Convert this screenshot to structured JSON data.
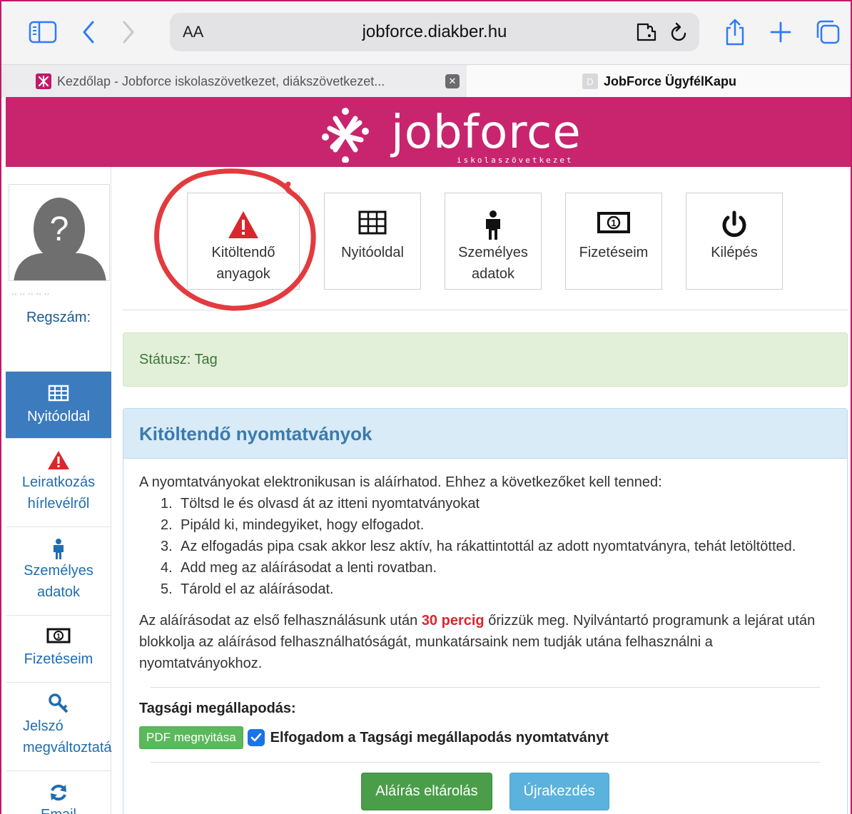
{
  "browser": {
    "aa_label": "AA",
    "url": "jobforce.diakber.hu",
    "tabs": [
      {
        "title": "Kezdőlap - Jobforce iskolaszövetkezet, diákszövetkezet...",
        "favicon": "jobforce-logo-icon"
      },
      {
        "title": "JobForce ÜgyfélKapu",
        "favicon": "D"
      }
    ]
  },
  "brand": {
    "name": "jobforce",
    "subtitle": "iskolaszövetkezet",
    "color": "#c8256e"
  },
  "sidebar": {
    "registration_label": "Regszám:",
    "items": [
      {
        "label": "Nyitóoldal",
        "icon": "table-icon",
        "active": true
      },
      {
        "label": "Leiratkozás hírlevélről",
        "icon": "warning-icon",
        "active": false
      },
      {
        "label": "Személyes adatok",
        "icon": "person-icon",
        "active": false
      },
      {
        "label": "Fizetéseim",
        "icon": "money-icon",
        "active": false
      },
      {
        "label": "Jelszó megváltoztatá",
        "icon": "key-icon",
        "active": false
      },
      {
        "label": "Email",
        "icon": "refresh-icon",
        "active": false
      }
    ]
  },
  "nav_cards": [
    {
      "label": "Kitöltendő anyagok",
      "icon": "warning-icon"
    },
    {
      "label": "Nyitóoldal",
      "icon": "table-icon"
    },
    {
      "label": "Személyes adatok",
      "icon": "person-icon"
    },
    {
      "label": "Fizetéseim",
      "icon": "money-icon"
    },
    {
      "label": "Kilépés",
      "icon": "power-icon"
    }
  ],
  "status": {
    "text": "Státusz: Tag"
  },
  "forms_panel": {
    "title": "Kitöltendő nyomtatványok",
    "intro": "A nyomtatványokat elektronikusan is aláírhatod. Ehhez a következőket kell tenned:",
    "steps": [
      "Töltsd le és olvasd át az itteni nyomtatványokat",
      "Pipáld ki, mindegyiket, hogy elfogadot.",
      "Az elfogadás pipa csak akkor lesz aktív, ha rákattintottál az adott nyomtatványra, tehát letöltötted.",
      "Add meg az aláírásodat a lenti rovatban.",
      "Tárold el az aláírásodat."
    ],
    "note_before": "Az aláírásodat az első felhasználásunk után ",
    "note_highlight": "30 percig",
    "note_after": " őrizzük meg. Nyilvántartó programunk a lejárat után blokkolja az aláírásod felhasználhatóságát, munkatársaink nem tudják utána felhasználni a nyomtatványokhoz.",
    "agreement_title": "Tagsági megállapodás:",
    "pdf_button": "PDF megnyitása",
    "agree_checked": true,
    "agree_text": "Elfogadom a Tagsági megállapodás nyomtatványt",
    "save_button": "Aláírás eltárolás",
    "reset_button": "Újrakezdés"
  }
}
